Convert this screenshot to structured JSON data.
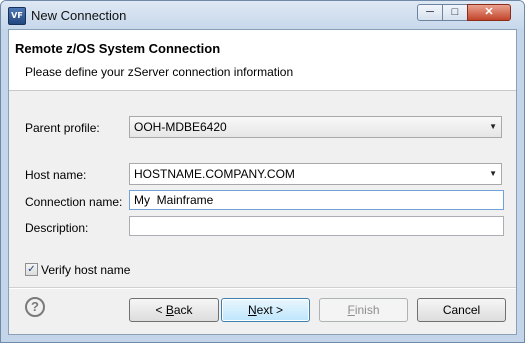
{
  "window": {
    "title": "New Connection",
    "app_icon_text": "VF"
  },
  "banner": {
    "title": "Remote z/OS System Connection",
    "description": "Please define your zServer connection information"
  },
  "form": {
    "parent_profile": {
      "label": "Parent profile:",
      "value": "OOH-MDBE6420"
    },
    "host_name": {
      "label": "Host name:",
      "value": "HOSTNAME.COMPANY.COM"
    },
    "connection_name": {
      "label": "Connection name:",
      "value": "My  Mainframe"
    },
    "description": {
      "label": "Description:",
      "value": ""
    },
    "verify_host": {
      "label": "Verify host name",
      "checked": true
    }
  },
  "buttons": {
    "back": {
      "mnemonic": "B",
      "rest": "ack",
      "prefix": "< "
    },
    "next": {
      "mnemonic": "N",
      "rest": "ext",
      "suffix": " >"
    },
    "finish": {
      "mnemonic": "F",
      "rest": "inish"
    },
    "cancel": {
      "label": "Cancel"
    }
  },
  "icons": {
    "help": "question-circle-icon",
    "dropdown": "chevron-down-icon",
    "check": "checkmark-icon"
  }
}
